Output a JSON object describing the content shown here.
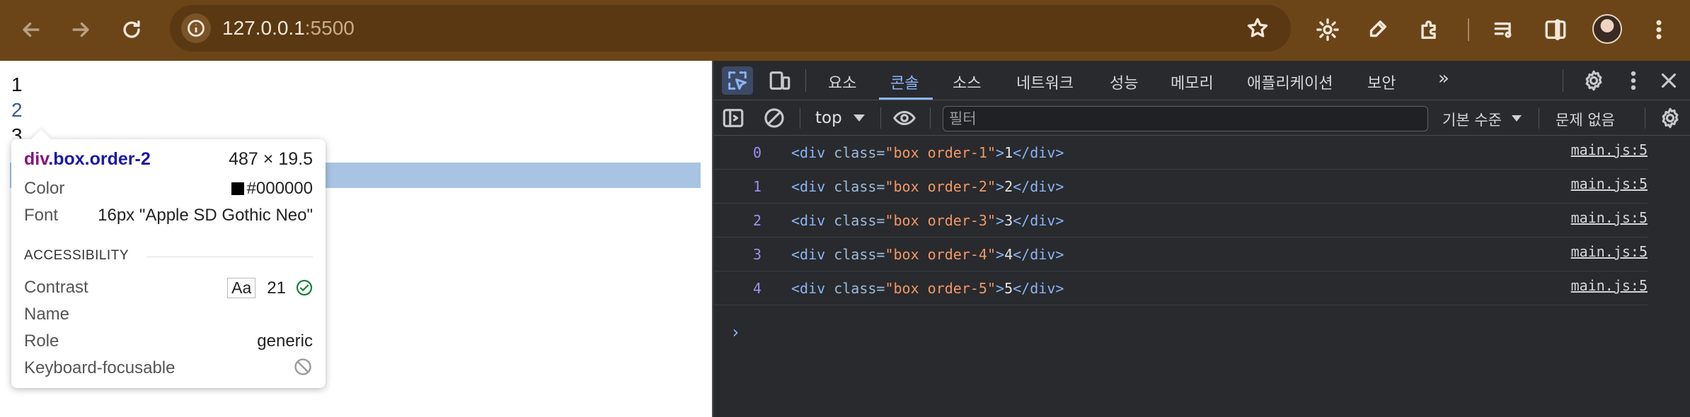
{
  "browser": {
    "url_host": "127.0.0.1",
    "url_port": ":5500",
    "icons": {
      "back": "arrow-left-icon",
      "forward": "arrow-right-icon",
      "reload": "reload-icon",
      "info": "info-icon",
      "bookmark": "star-icon",
      "ext1": "gear-extension-icon",
      "ext2": "eyedropper-icon",
      "extensions": "puzzle-icon",
      "media": "media-queue-icon",
      "sidepanel": "side-panel-icon",
      "menu": "kebab-menu-icon"
    },
    "colors": {
      "toolbar": "#6b4518",
      "omnibox": "#5a3812"
    }
  },
  "page": {
    "boxes": [
      "1",
      "2",
      "3"
    ],
    "tooltip": {
      "selector_tag": "div",
      "selector_class": ".box.order-2",
      "size": "487 × 19.5",
      "color_label": "Color",
      "color_value": "#000000",
      "font_label": "Font",
      "font_value": "16px \"Apple SD Gothic Neo\"",
      "accessibility_heading": "ACCESSIBILITY",
      "contrast_label": "Contrast",
      "contrast_sample": "Aa",
      "contrast_value": "21",
      "name_label": "Name",
      "role_label": "Role",
      "role_value": "generic",
      "keyboard_label": "Keyboard-focusable"
    },
    "highlight_color": "#a8c4e2"
  },
  "devtools": {
    "tabs": [
      "요소",
      "콘솔",
      "소스",
      "네트워크",
      "성능",
      "메모리",
      "애플리케이션",
      "보안"
    ],
    "active_tab": "콘솔",
    "more_tabs": "»",
    "context": "top",
    "filter_placeholder": "필터",
    "levels": "기본 수준",
    "issues": "문제 없음",
    "logs": [
      {
        "index": "0",
        "tag_open": "<div ",
        "attr": "class=",
        "value": "\"box order-1\"",
        "close": ">",
        "text": "1",
        "tag_close": "</div>",
        "source": "main.js:5"
      },
      {
        "index": "1",
        "tag_open": "<div ",
        "attr": "class=",
        "value": "\"box order-2\"",
        "close": ">",
        "text": "2",
        "tag_close": "</div>",
        "source": "main.js:5"
      },
      {
        "index": "2",
        "tag_open": "<div ",
        "attr": "class=",
        "value": "\"box order-3\"",
        "close": ">",
        "text": "3",
        "tag_close": "</div>",
        "source": "main.js:5"
      },
      {
        "index": "3",
        "tag_open": "<div ",
        "attr": "class=",
        "value": "\"box order-4\"",
        "close": ">",
        "text": "4",
        "tag_close": "</div>",
        "source": "main.js:5"
      },
      {
        "index": "4",
        "tag_open": "<div ",
        "attr": "class=",
        "value": "\"box order-5\"",
        "close": ">",
        "text": "5",
        "tag_close": "</div>",
        "source": "main.js:5"
      }
    ],
    "prompt": "›",
    "colors": {
      "background": "#292a2d",
      "accent": "#8ab4f8",
      "attr_value": "#f29766",
      "index": "#9e8ff0"
    }
  }
}
